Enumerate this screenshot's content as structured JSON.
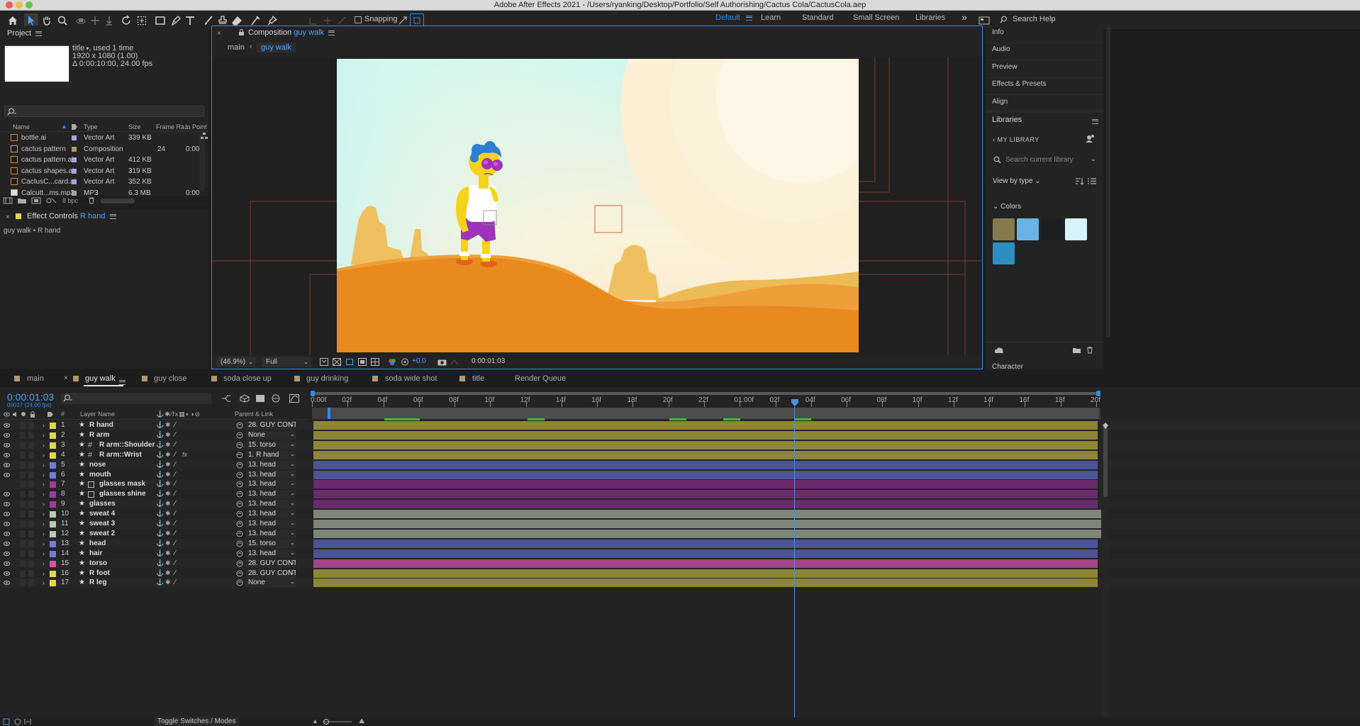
{
  "window": {
    "title": "Adobe After Effects 2021 - /Users/ryanking/Desktop/Portfolio/Self Authorishing/Cactus Cola/CactusCola.aep"
  },
  "toolbar": {
    "snapping_label": "Snapping",
    "workspaces": [
      "Default",
      "Learn",
      "Standard",
      "Small Screen",
      "Libraries"
    ],
    "active_workspace": "Default",
    "search_help_placeholder": "Search Help"
  },
  "project": {
    "title": "Project",
    "item_name": "title",
    "item_used": ", used 1 time",
    "item_dims": "1920 x 1080 (1.00)",
    "item_duration": "Δ 0:00:10:00, 24.00 fps",
    "columns": [
      "Name",
      "Type",
      "Size",
      "Frame Ra...",
      "In Point"
    ],
    "rows": [
      {
        "name": "bottle.ai",
        "type": "Vector Art",
        "size": "339 KB",
        "fr": "",
        "in": "",
        "color": "#a5a5e0"
      },
      {
        "name": "cactus pattern",
        "type": "Composition",
        "size": "",
        "fr": "24",
        "in": "0:00",
        "color": "#b09a6a"
      },
      {
        "name": "cactus pattern.ai",
        "type": "Vector Art",
        "size": "412 KB",
        "fr": "",
        "in": "",
        "color": "#a5a5e0"
      },
      {
        "name": "cactus shapes.ai",
        "type": "Vector Art",
        "size": "319 KB",
        "fr": "",
        "in": "",
        "color": "#a5a5e0"
      },
      {
        "name": "CactusC...card.ai",
        "type": "Vector Art",
        "size": "352 KB",
        "fr": "",
        "in": "",
        "color": "#a5a5e0"
      },
      {
        "name": "Calcutt...ms.mp3",
        "type": "MP3",
        "size": "6.3 MB",
        "fr": "",
        "in": "0:00",
        "color": "#a5a5a5"
      }
    ],
    "bpc": "8 bpc"
  },
  "effect_controls": {
    "title": "Effect Controls",
    "layer": "R hand",
    "path": "guy walk • R hand"
  },
  "composition": {
    "title": "Composition",
    "comp_name": "guy walk",
    "breadcrumb": [
      "main",
      "guy walk"
    ],
    "zoom": "(46.9%)",
    "resolution": "Full",
    "exposure": "+0.0",
    "timecode": "0:00:01:03"
  },
  "right_panel": {
    "items": [
      "Info",
      "Audio",
      "Preview",
      "Effects & Presets",
      "Align"
    ],
    "libraries_title": "Libraries",
    "my_library": "MY LIBRARY",
    "search_placeholder": "Search current library",
    "view_by": "View by type",
    "colors_label": "Colors",
    "colors": [
      "#857a4d",
      "#6cb3e5",
      "#1c1f22",
      "#d8f3fb",
      "#2f8dc2"
    ],
    "character": "Character"
  },
  "timeline": {
    "tabs": [
      "main",
      "guy walk",
      "guy close",
      "soda close up",
      "guy drinking",
      "soda wide shot",
      "title",
      "Render Queue"
    ],
    "active_tab": "guy walk",
    "timecode": "0:00:01:03",
    "frame_info": "00027 (24.00 fps)",
    "col_num": "#",
    "col_layer": "Layer Name",
    "col_parent": "Parent & Link",
    "ruler": [
      "0:00f",
      "02f",
      "04f",
      "06f",
      "08f",
      "10f",
      "12f",
      "14f",
      "16f",
      "18f",
      "20f",
      "22f",
      "01:00f",
      "02f",
      "04f",
      "06f",
      "08f",
      "10f",
      "12f",
      "14f",
      "16f",
      "18f",
      "20f"
    ],
    "layers": [
      {
        "n": "1",
        "name": "R hand",
        "parent": "28. GUY CONT",
        "color": "#e0d64a",
        "bar": "#8d8637",
        "icon": "star",
        "fx": false
      },
      {
        "n": "2",
        "name": "R arm",
        "parent": "None",
        "color": "#e0d64a",
        "bar": "#8d8637",
        "icon": "star",
        "fx": false
      },
      {
        "n": "3",
        "name": "R arm::Shoulder",
        "parent": "15. torso",
        "color": "#e0d64a",
        "bar": "#8d8637",
        "icon": "hash",
        "fx": false
      },
      {
        "n": "4",
        "name": "R arm::Wrist",
        "parent": "1. R hand",
        "color": "#e0d64a",
        "bar": "#8d8637",
        "icon": "hash",
        "fx": true
      },
      {
        "n": "5",
        "name": "nose",
        "parent": "13. head",
        "color": "#6f7de0",
        "bar": "#4b5494",
        "icon": "star",
        "fx": false
      },
      {
        "n": "6",
        "name": "mouth",
        "parent": "13. head",
        "color": "#6f7de0",
        "bar": "#4b5494",
        "icon": "star",
        "fx": false
      },
      {
        "n": "7",
        "name": "glasses mask",
        "parent": "13. head",
        "color": "#a23aa6",
        "bar": "#6b2a6e",
        "icon": "box",
        "fx": false
      },
      {
        "n": "8",
        "name": "glasses shine",
        "parent": "13. head",
        "color": "#a23aa6",
        "bar": "#6b2a6e",
        "icon": "box",
        "fx": false
      },
      {
        "n": "9",
        "name": "glasses",
        "parent": "13. head",
        "color": "#a23aa6",
        "bar": "#6b2a6e",
        "icon": "star",
        "fx": false
      },
      {
        "n": "10",
        "name": "sweat 4",
        "parent": "13. head",
        "color": "#b9c9b3",
        "bar": "#7e8679",
        "icon": "star",
        "fx": false
      },
      {
        "n": "11",
        "name": "sweat 3",
        "parent": "13. head",
        "color": "#b9c9b3",
        "bar": "#7e8679",
        "icon": "star",
        "fx": false
      },
      {
        "n": "12",
        "name": "sweat 2",
        "parent": "13. head",
        "color": "#b9c9b3",
        "bar": "#7e8679",
        "icon": "star",
        "fx": false
      },
      {
        "n": "13",
        "name": "head",
        "parent": "15. torso",
        "color": "#6f7de0",
        "bar": "#4b5494",
        "icon": "star",
        "fx": false
      },
      {
        "n": "14",
        "name": "hair",
        "parent": "13. head",
        "color": "#6f7de0",
        "bar": "#4b5494",
        "icon": "star",
        "fx": false
      },
      {
        "n": "15",
        "name": "torso",
        "parent": "28. GUY CONT",
        "color": "#e24fa8",
        "bar": "#a24584",
        "icon": "star",
        "fx": false
      },
      {
        "n": "16",
        "name": "R foot",
        "parent": "28. GUY CONT",
        "color": "#e0d64a",
        "bar": "#8d8637",
        "icon": "star",
        "fx": false
      },
      {
        "n": "17",
        "name": "R leg",
        "parent": "None",
        "color": "#e0d64a",
        "bar": "#8d8637",
        "icon": "star",
        "fx": false
      }
    ],
    "toggle_label": "Toggle Switches / Modes"
  },
  "colors": {
    "accent": "#2d8ceb",
    "playhead": "#4a90e2"
  }
}
